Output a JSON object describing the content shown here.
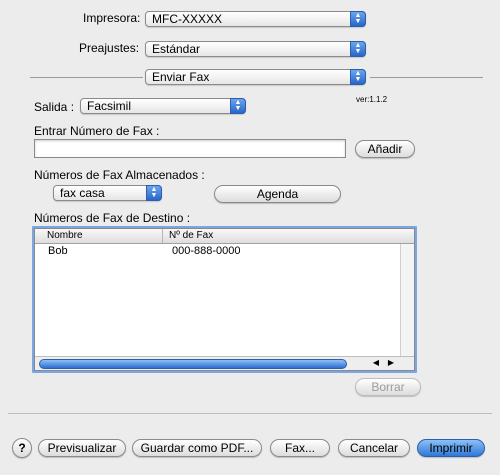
{
  "printer": {
    "label": "Impresora:",
    "value": "MFC-XXXXX"
  },
  "presets": {
    "label": "Preajustes:",
    "value": "Estándar"
  },
  "panel_select": {
    "value": "Enviar Fax"
  },
  "version": "ver:1.1.2",
  "output": {
    "label": "Salida :",
    "value": "Facsimil"
  },
  "enter_fax": {
    "label": "Entrar Número de Fax :",
    "value": "",
    "add_button": "Añadir"
  },
  "stored": {
    "label": "Números de Fax Almacenados :",
    "value": "fax casa",
    "agenda_button": "Agenda"
  },
  "destination": {
    "label": "Números de Fax de Destino :",
    "columns": [
      "Nombre",
      "Nº de Fax"
    ],
    "rows": [
      {
        "name": "Bob",
        "fax": "000-888-0000"
      }
    ],
    "delete_button": "Borrar"
  },
  "bottom": {
    "help": "?",
    "preview": "Previsualizar",
    "save_pdf": "Guardar como PDF...",
    "fax": "Fax...",
    "cancel": "Cancelar",
    "print": "Imprimir"
  },
  "colors": {
    "accent": "#2f78d8",
    "background": "#ececec"
  }
}
